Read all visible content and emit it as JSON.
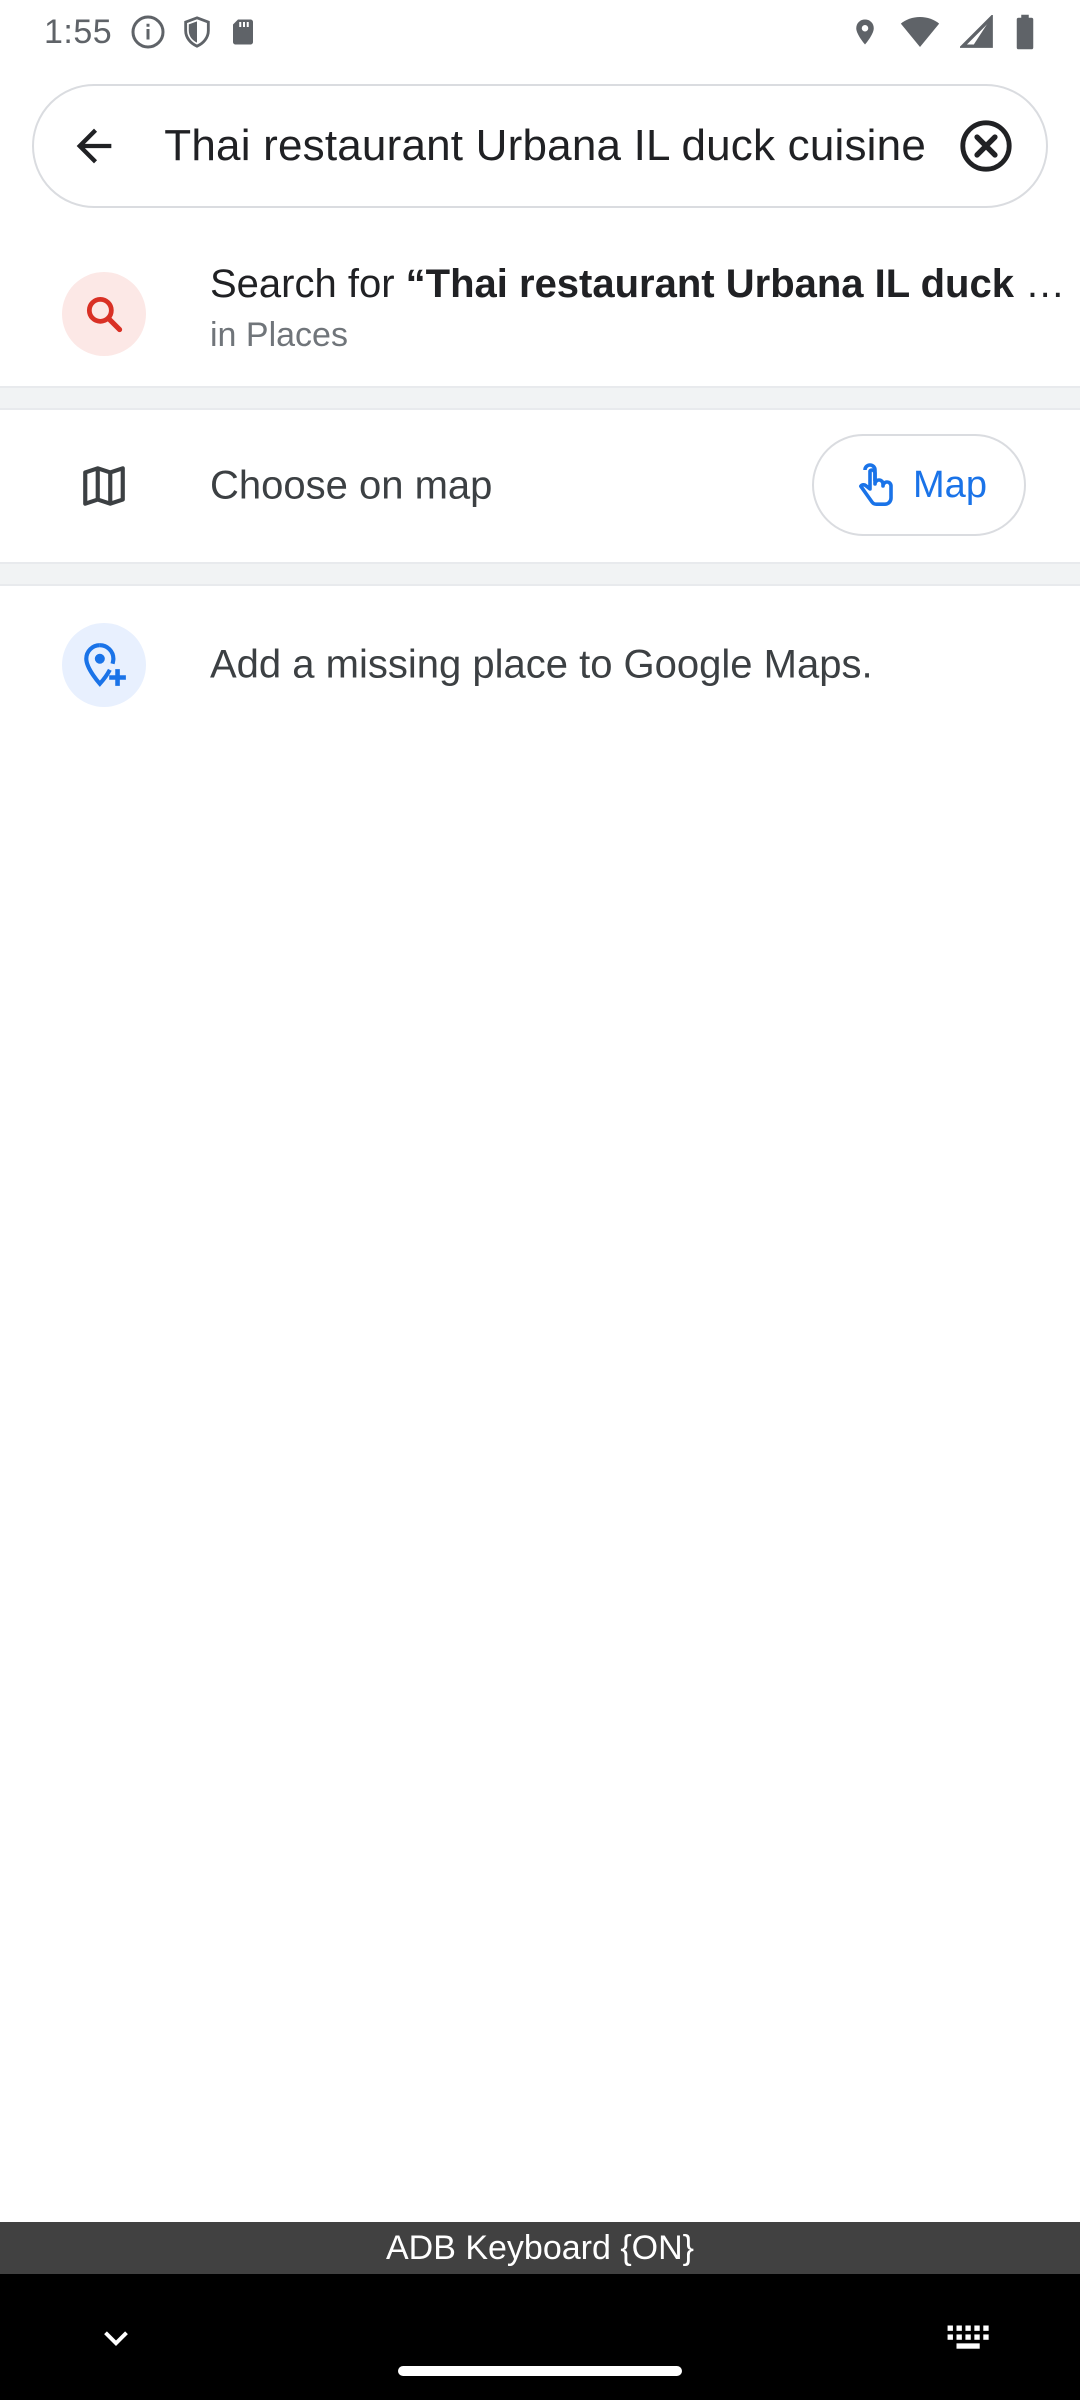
{
  "status_bar": {
    "time": "1:55",
    "left_icons": [
      "info-icon",
      "shield-icon",
      "sd-card-icon"
    ],
    "right_icons": [
      "location-icon",
      "wifi-icon",
      "signal-icon",
      "battery-icon"
    ]
  },
  "search_bar": {
    "query": "Thai restaurant Urbana IL duck cuisine",
    "back_icon": "arrow-back-icon",
    "clear_icon": "clear-circle-icon"
  },
  "suggestion": {
    "prefix": "Search for ",
    "open_quote": "“",
    "query_bold": "Thai restaurant Urbana IL duck cuisine",
    "close_quote": "”",
    "subtitle": "in Places",
    "icon": "search-icon",
    "icon_color": "#d93025",
    "icon_bg": "#fce8e6"
  },
  "choose_on_map": {
    "label": "Choose on map",
    "icon": "map-icon",
    "button_label": "Map",
    "button_icon": "touch-icon",
    "accent": "#1a73e8"
  },
  "add_missing_place": {
    "label": "Add a missing place to Google Maps.",
    "icon": "add-location-icon",
    "icon_color": "#1a73e8",
    "icon_bg": "#e8f0fe"
  },
  "keyboard_indicator": {
    "label": "ADB Keyboard {ON}"
  },
  "nav_bar": {
    "left_icon": "chevron-down-icon",
    "right_icon": "keyboard-icon"
  }
}
